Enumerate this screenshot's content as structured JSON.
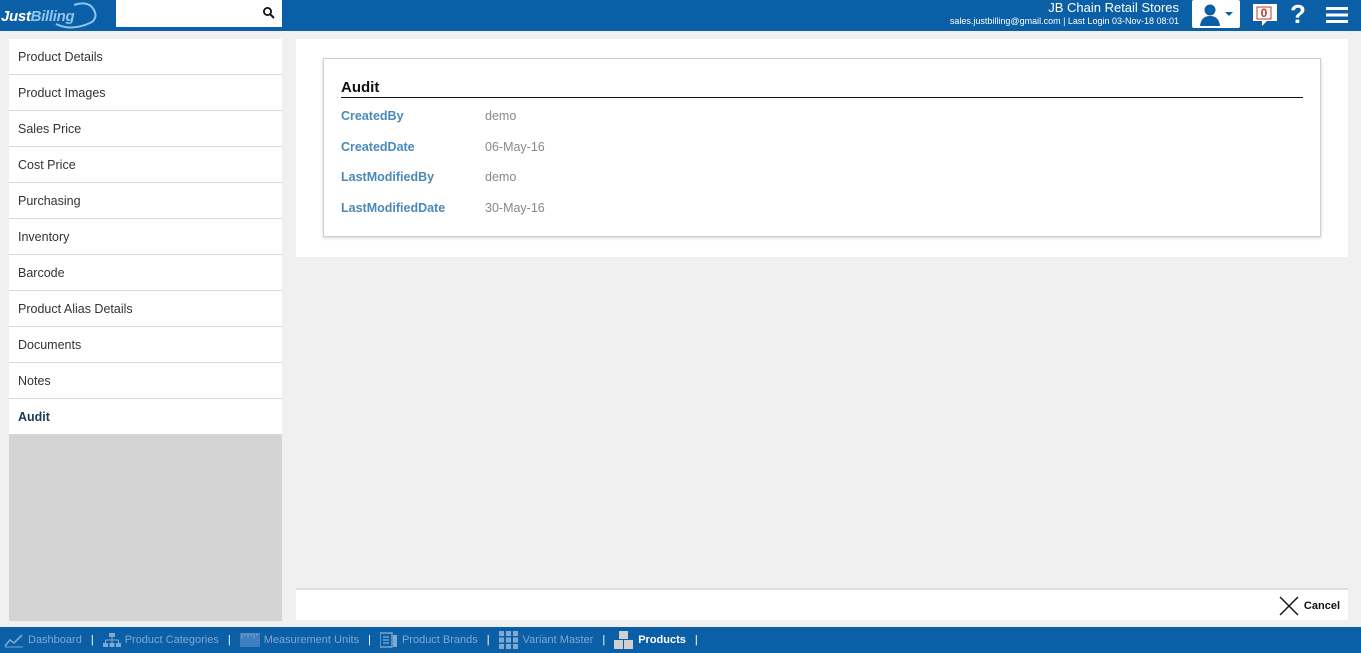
{
  "header": {
    "logo_text_a": "Just",
    "logo_text_b": "Billing",
    "search_placeholder": "",
    "company_name": "JB Chain Retail Stores",
    "company_sub": "sales.justbilling@gmail.com | Last Login 03-Nov-18 08:01",
    "notification_count": "0",
    "help_glyph": "?"
  },
  "sidebar": {
    "items": [
      {
        "label": "Product Details"
      },
      {
        "label": "Product Images"
      },
      {
        "label": "Sales Price"
      },
      {
        "label": "Cost Price"
      },
      {
        "label": "Purchasing"
      },
      {
        "label": "Inventory"
      },
      {
        "label": "Barcode"
      },
      {
        "label": "Product Alias Details"
      },
      {
        "label": "Documents"
      },
      {
        "label": "Notes"
      },
      {
        "label": "Audit"
      }
    ],
    "active": "Audit"
  },
  "audit": {
    "title": "Audit",
    "rows": [
      {
        "label": "CreatedBy",
        "value": "demo"
      },
      {
        "label": "CreatedDate",
        "value": "06-May-16"
      },
      {
        "label": "LastModifiedBy",
        "value": "demo"
      },
      {
        "label": "LastModifiedDate",
        "value": "30-May-16"
      }
    ]
  },
  "footer": {
    "cancel_label": "Cancel"
  },
  "bottom_nav": {
    "items": [
      {
        "label": "Dashboard",
        "icon": "chart-line-icon"
      },
      {
        "label": "Product Categories",
        "icon": "hierarchy-icon"
      },
      {
        "label": "Measurement Units",
        "icon": "ruler-icon"
      },
      {
        "label": "Product Brands",
        "icon": "brand-icon"
      },
      {
        "label": "Variant Master",
        "icon": "grid-icon"
      },
      {
        "label": "Products",
        "icon": "boxes-icon"
      }
    ],
    "active": "Products"
  },
  "colors": {
    "brand_blue": "#0b5fa6",
    "label_blue": "#4a89b8",
    "notification_red": "#c0392b"
  }
}
